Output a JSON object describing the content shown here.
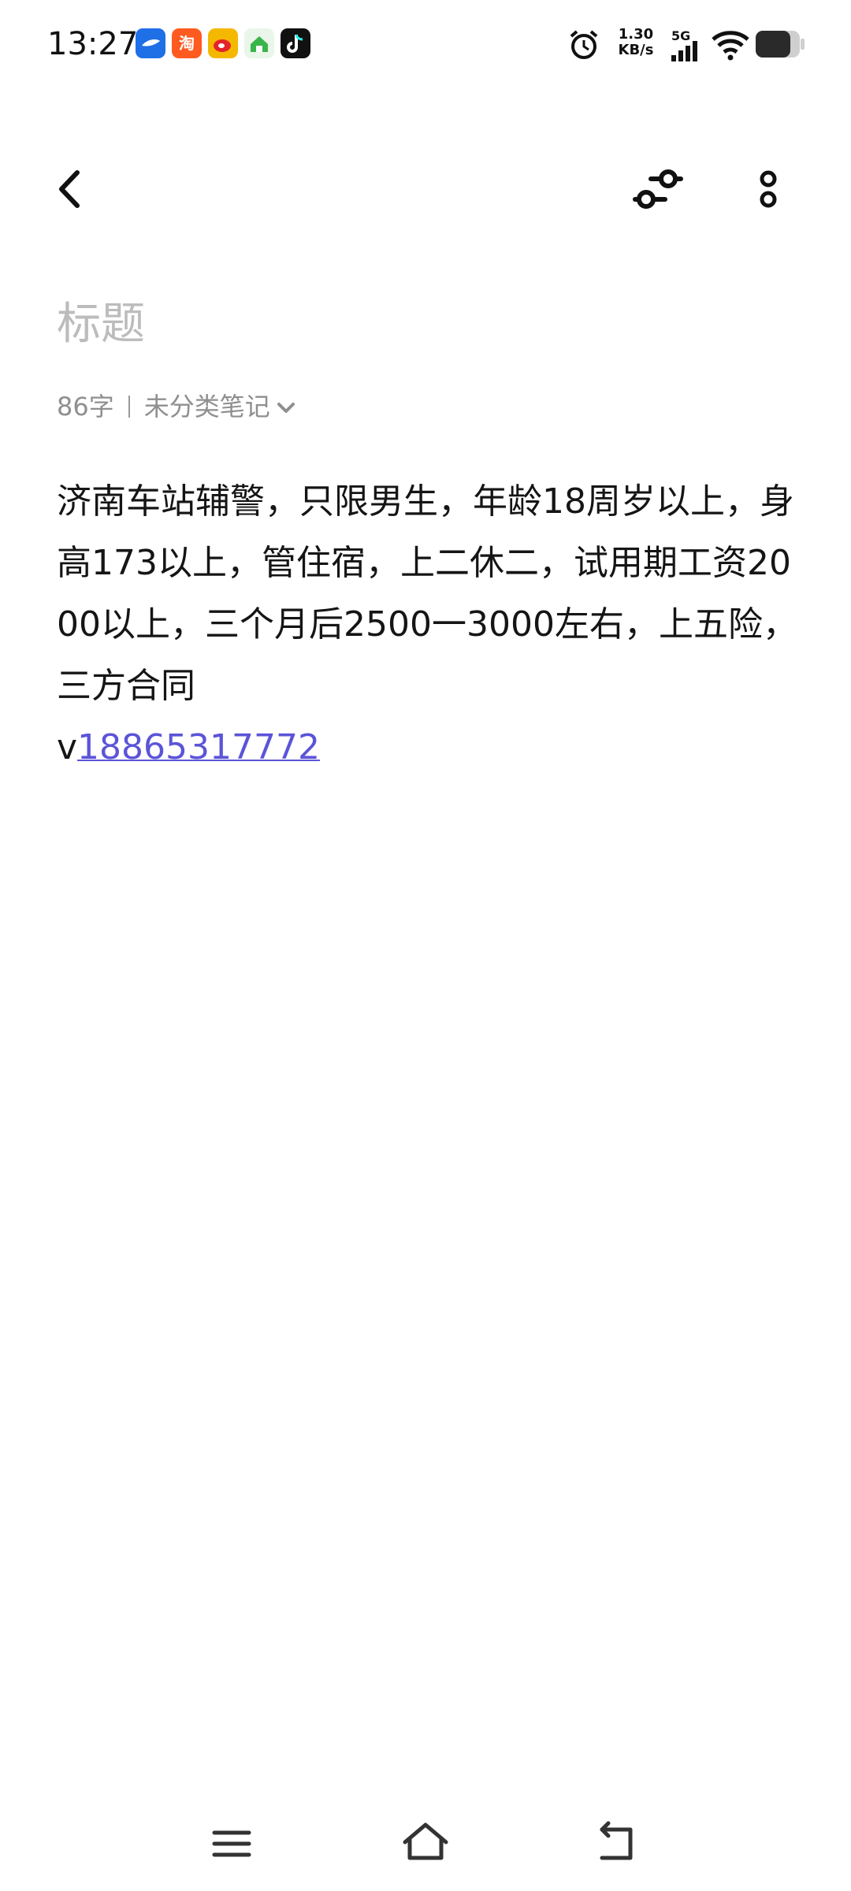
{
  "status_bar": {
    "time": "13:27",
    "apps": [
      {
        "icon": "blue-app-icon",
        "color": "#1f6fe6"
      },
      {
        "icon": "taobao-icon",
        "glyph": "淘",
        "color": "#ff5a1f"
      },
      {
        "icon": "weibo-icon",
        "color": "#f5b800"
      },
      {
        "icon": "home-app-icon",
        "color": "#39b54a"
      },
      {
        "icon": "tiktok-icon",
        "color": "#111111"
      }
    ],
    "network_speed_value": "1.30",
    "network_speed_unit": "KB/s",
    "network_type": "5G"
  },
  "toolbar": {
    "back_icon": "back-arrow-icon",
    "filter_icon": "sliders-icon",
    "more_icon": "more-vertical-icon"
  },
  "note": {
    "title_placeholder": "标题",
    "word_count": "86字",
    "category": "未分类笔记",
    "body_text": "济南车站辅警，只限男生，年龄18周岁以上，身高173以上，管住宿，上二休二，试用期工资2000以上，三个月后2500一3000左右，上五险，三方合同",
    "contact_prefix": "v",
    "contact_phone": "18865317772",
    "link_color": "#5b54d8"
  },
  "navigation": {
    "menu_icon": "menu-icon",
    "home_icon": "home-icon",
    "back_icon": "back-gesture-icon"
  }
}
